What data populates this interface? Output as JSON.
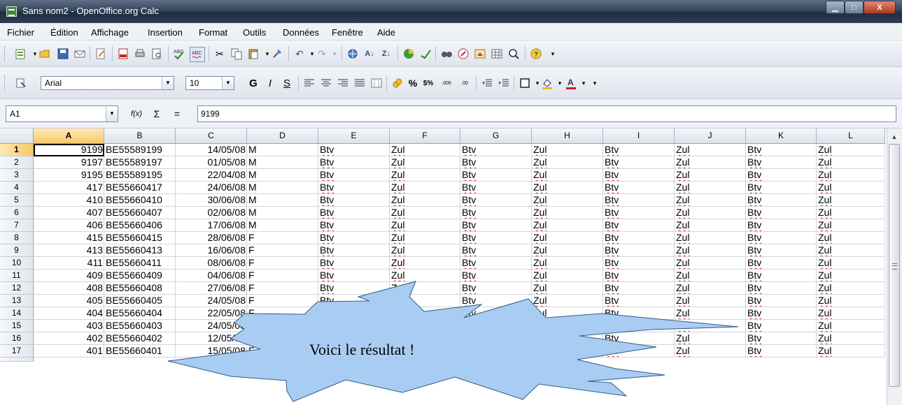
{
  "window": {
    "title": "Sans nom2 - OpenOffice.org Calc",
    "buttons": {
      "minimize": "▁",
      "maximize": "□",
      "close": "X"
    }
  },
  "menu": [
    "Fichier",
    "Édition",
    "Affichage",
    "Insertion",
    "Format",
    "Outils",
    "Données",
    "Fenêtre",
    "Aide"
  ],
  "toolbar": {
    "font_name": "Arial",
    "font_size": "10",
    "bold": "G",
    "italic": "I",
    "underline": "S",
    "percent": "%",
    "currency": "$%",
    "decimal_add": ".000",
    "decimal_remove": ".00"
  },
  "formula_bar": {
    "cell_ref": "A1",
    "function_icon": "f(x)",
    "sum_icon": "Σ",
    "equals_icon": "=",
    "value": "9199"
  },
  "columns": [
    "A",
    "B",
    "C",
    "D",
    "E",
    "F",
    "G",
    "H",
    "I",
    "J",
    "K",
    "L"
  ],
  "rows": [
    {
      "n": "1",
      "a": "9199",
      "b": "BE55589199",
      "c": "14/05/08",
      "d": "M"
    },
    {
      "n": "2",
      "a": "9197",
      "b": "BE55589197",
      "c": "01/05/08",
      "d": "M"
    },
    {
      "n": "3",
      "a": "9195",
      "b": "BE55589195",
      "c": "22/04/08",
      "d": "M"
    },
    {
      "n": "4",
      "a": "417",
      "b": "BE55660417",
      "c": "24/06/08",
      "d": "M"
    },
    {
      "n": "5",
      "a": "410",
      "b": "BE55660410",
      "c": "30/06/08",
      "d": "M"
    },
    {
      "n": "6",
      "a": "407",
      "b": "BE55660407",
      "c": "02/06/08",
      "d": "M"
    },
    {
      "n": "7",
      "a": "406",
      "b": "BE55660406",
      "c": "17/06/08",
      "d": "M"
    },
    {
      "n": "8",
      "a": "415",
      "b": "BE55660415",
      "c": "28/06/08",
      "d": "F"
    },
    {
      "n": "9",
      "a": "413",
      "b": "BE55660413",
      "c": "16/06/08",
      "d": "F"
    },
    {
      "n": "10",
      "a": "411",
      "b": "BE55660411",
      "c": "08/06/08",
      "d": "F"
    },
    {
      "n": "11",
      "a": "409",
      "b": "BE55660409",
      "c": "04/06/08",
      "d": "F"
    },
    {
      "n": "12",
      "a": "408",
      "b": "BE55660408",
      "c": "27/06/08",
      "d": "F"
    },
    {
      "n": "13",
      "a": "405",
      "b": "BE55660405",
      "c": "24/05/08",
      "d": "F"
    },
    {
      "n": "14",
      "a": "404",
      "b": "BE55660404",
      "c": "22/05/08",
      "d": "F"
    },
    {
      "n": "15",
      "a": "403",
      "b": "BE55660403",
      "c": "24/05/08",
      "d": "F"
    },
    {
      "n": "16",
      "a": "402",
      "b": "BE55660402",
      "c": "12/05/08",
      "d": "F"
    },
    {
      "n": "17",
      "a": "401",
      "b": "BE55660401",
      "c": "15/05/08",
      "d": "F"
    }
  ],
  "repeat_values": [
    "Btv",
    "Zul"
  ],
  "callout": {
    "text": "Voici le résultat !",
    "fill_color": "#a9cdf2",
    "stroke_color": "#2f5a86"
  },
  "colors": {
    "title_bar": "#34455c",
    "selected_header": "#f7c96a",
    "spell_underline": "#e02020"
  }
}
